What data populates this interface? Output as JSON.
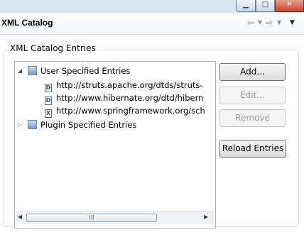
{
  "window": {
    "min_glyph": "▁",
    "max_glyph": "□",
    "close_glyph": "✕"
  },
  "header": {
    "title": "XML Catalog",
    "nav_icons": [
      "back-icon",
      "dropdown-icon",
      "forward-icon",
      "dropdown-icon",
      "view-menu-icon"
    ]
  },
  "group": {
    "title": "XML Catalog Entries"
  },
  "tree": {
    "user": {
      "label": "User Specified Entries",
      "children": [
        {
          "label": "http://struts.apache.org/dtds/struts-",
          "icon": "D"
        },
        {
          "label": "http://www.hibernate.org/dtd/hibern",
          "icon": "D"
        },
        {
          "label": "http://www.springframework.org/sch",
          "icon": "X"
        }
      ]
    },
    "plugin": {
      "label": "Plugin Specified Entries"
    },
    "scroll_thumb": "III"
  },
  "buttons": {
    "add": "Add...",
    "edit": "Edit...",
    "remove": "Remove",
    "reload": "Reload Entries"
  }
}
